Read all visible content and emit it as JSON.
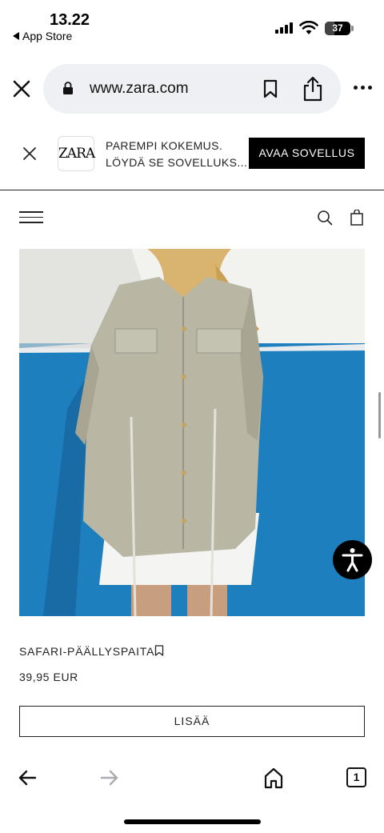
{
  "status_bar": {
    "time": "13.22",
    "back_app": "App Store",
    "battery": "37"
  },
  "browser": {
    "url": "www.zara.com",
    "icons": [
      "close-icon",
      "lock-icon",
      "bookmark-icon",
      "share-icon",
      "more-icon"
    ]
  },
  "app_banner": {
    "logo": "ZARA",
    "line1": "PAREMPI KOKEMUS.",
    "line2": "LÖYDÄ SE SOVELLUKS...",
    "button": "AVAA SOVELLUS"
  },
  "header": {
    "icons": [
      "menu-icon",
      "search-icon",
      "bag-icon"
    ]
  },
  "product": {
    "name": "SAFARI-PÄÄLLYSPAITA",
    "price": "39,95 EUR",
    "add_button": "LISÄÄ"
  },
  "toolbar": {
    "tabs_count": "1",
    "icons": [
      "back-arrow-icon",
      "forward-arrow-icon",
      "home-icon",
      "tabs-icon"
    ]
  },
  "colors": {
    "wall_white": "#f2f2ef",
    "wall_blue": "#1e7fbf",
    "shirt": "#b9b7a4",
    "shorts": "#f4f4f2"
  }
}
